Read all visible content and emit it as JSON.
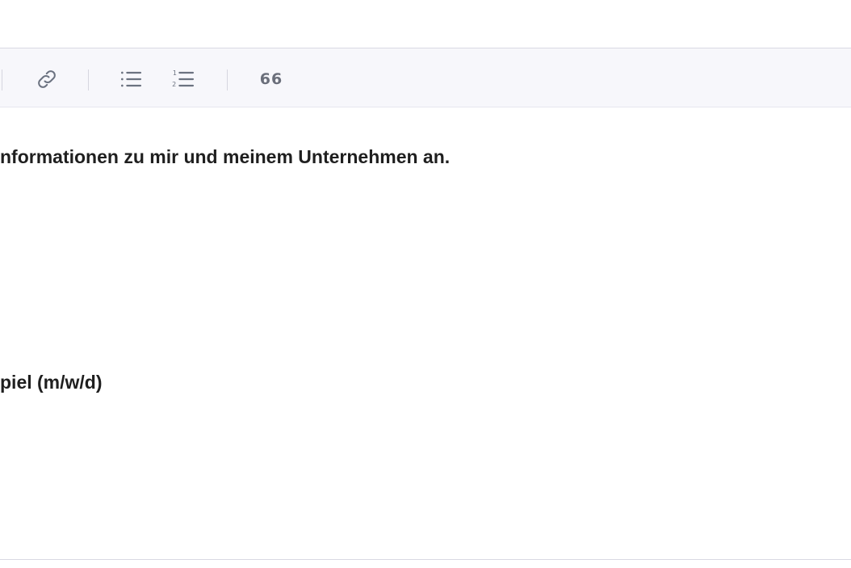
{
  "toolbar": {
    "buttons": [
      {
        "name": "link",
        "icon": "link-icon"
      },
      {
        "name": "bullet-list",
        "icon": "bullet-list-icon"
      },
      {
        "name": "numbered-list",
        "icon": "numbered-list-icon"
      },
      {
        "name": "blockquote",
        "icon": "quote-icon",
        "glyph": "66"
      }
    ]
  },
  "content": {
    "lines": [
      "nformationen zu mir und meinem Unternehmen an.",
      "piel (m/w/d)"
    ]
  },
  "colors": {
    "toolbar_bg": "#f7f7fb",
    "border": "#d9d9e3",
    "icon": "#6b7280",
    "text": "#1f1f1f"
  }
}
